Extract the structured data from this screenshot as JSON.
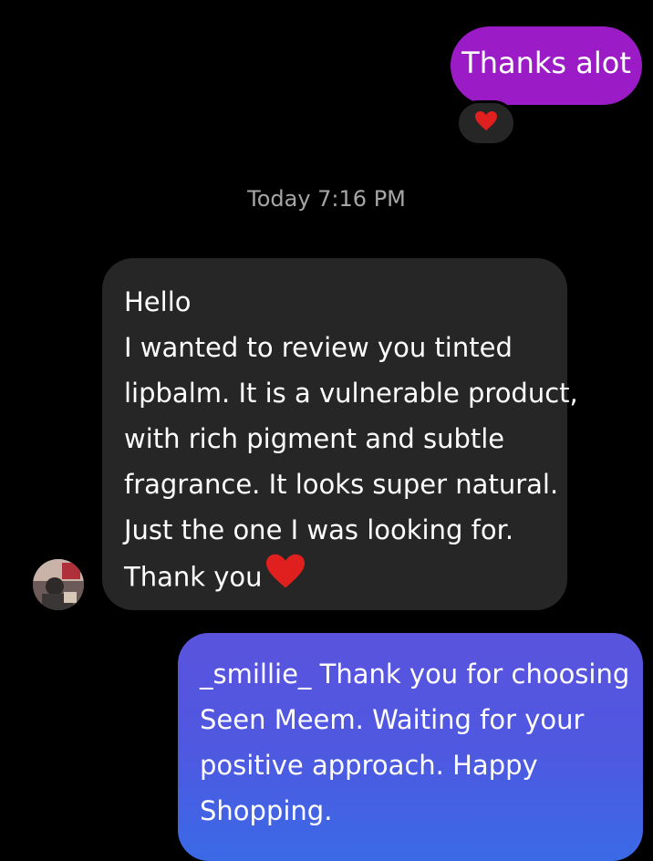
{
  "messages": {
    "outgoing_1": {
      "text": "Thanks alot",
      "color": "#9b1cc7"
    },
    "reaction": {
      "icon": "red-heart"
    },
    "timestamp": "Today 7:16 PM",
    "incoming": {
      "lines": [
        "Hello",
        "I wanted to review you tinted",
        "lipbalm. It is a vulnerable product,",
        "with rich pigment and subtle",
        "fragrance. It looks super natural.",
        "Just the one I was looking for.",
        "Thank you"
      ],
      "trailing_icon": "red-heart",
      "bubble_color": "#262626"
    },
    "outgoing_2": {
      "lines": [
        "_smillie_ Thank you for choosing",
        "Seen Meem. Waiting for your",
        "positive approach. Happy",
        "Shopping."
      ],
      "gradient": [
        "#5a53de",
        "#3a6ae6"
      ]
    }
  }
}
